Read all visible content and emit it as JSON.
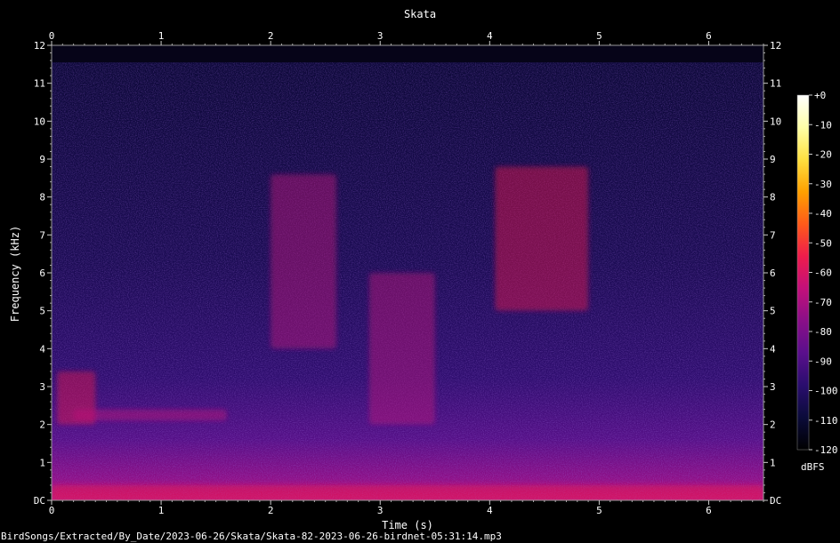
{
  "chart_data": {
    "type": "heatmap",
    "title": "Skata",
    "xlabel": "Time (s)",
    "ylabel": "Frequency (kHz)",
    "xlim": [
      0,
      6.5
    ],
    "ylim": [
      0,
      12
    ],
    "x_ticks": [
      "0",
      "1",
      "2",
      "3",
      "4",
      "5",
      "6"
    ],
    "y_ticks": [
      "DC",
      "1",
      "2",
      "3",
      "4",
      "5",
      "6",
      "7",
      "8",
      "9",
      "10",
      "11",
      "12"
    ],
    "colorbar": {
      "unit": "dBFS",
      "range": [
        -120,
        0
      ],
      "ticks": [
        "+0",
        "-10",
        "-20",
        "-30",
        "-40",
        "-50",
        "-60",
        "-70",
        "-80",
        "-90",
        "-100",
        "-110",
        "-120"
      ],
      "colors": [
        "#000000",
        "#0b0b3a",
        "#2a0e6e",
        "#5a0f8c",
        "#8a0f88",
        "#c3107a",
        "#ee1c4c",
        "#ff5a1a",
        "#ffa000",
        "#ffe040",
        "#ffffa8",
        "#ffffff"
      ]
    },
    "grid": true,
    "features": [
      {
        "t": [
          0.05,
          0.4
        ],
        "f": [
          2.0,
          3.4
        ],
        "level_dbfs": -55
      },
      {
        "t": [
          0.2,
          1.6
        ],
        "f": [
          2.1,
          2.4
        ],
        "level_dbfs": -70
      },
      {
        "t": [
          2.0,
          2.6
        ],
        "f": [
          4.0,
          8.6
        ],
        "level_dbfs": -62
      },
      {
        "t": [
          2.9,
          3.5
        ],
        "f": [
          2.0,
          6.0
        ],
        "level_dbfs": -64
      },
      {
        "t": [
          4.05,
          4.9
        ],
        "f": [
          5.0,
          8.8
        ],
        "level_dbfs": -60
      },
      {
        "t": [
          0.0,
          6.5
        ],
        "f": [
          0.0,
          0.4
        ],
        "level_dbfs": -60
      }
    ]
  },
  "footer_path": "BirdSongs/Extracted/By_Date/2023-06-26/Skata/Skata-82-2023-06-26-birdnet-05:31:14.mp3"
}
